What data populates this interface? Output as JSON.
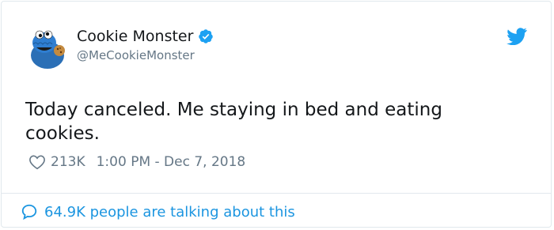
{
  "author": {
    "display_name": "Cookie Monster",
    "handle": "@MeCookieMonster",
    "verified": true,
    "avatar_icon": "cookie-monster-avatar"
  },
  "tweet": {
    "text": "Today canceled. Me staying in bed and eating cookies.",
    "like_count": "213K",
    "timestamp": "1:00 PM - Dec 7, 2018"
  },
  "footer": {
    "conversation_label": "64.9K people are talking about this"
  },
  "colors": {
    "brand_blue": "#1da1f2",
    "link_blue": "#1b95e0",
    "text_primary": "#14171a",
    "text_secondary": "#657786",
    "border": "#e1e8ed"
  }
}
